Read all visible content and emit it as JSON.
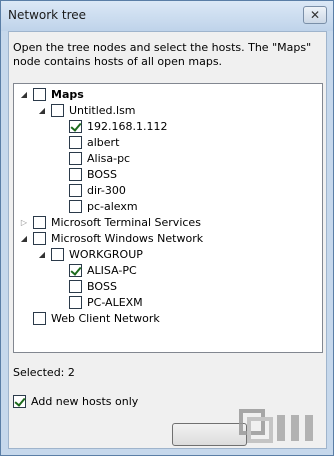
{
  "window": {
    "title": "Network tree",
    "close_glyph": "✕"
  },
  "description": "Open the tree nodes and select the hosts. The \"Maps\" node contains hosts of all open maps.",
  "tree": {
    "nodes": [
      {
        "label": "Maps",
        "checked": false,
        "expander": "expanded",
        "bold": true
      },
      {
        "label": "Untitled.lsm",
        "checked": false,
        "expander": "expanded"
      },
      {
        "label": "192.168.1.112",
        "checked": true,
        "expander": "none"
      },
      {
        "label": "albert",
        "checked": false,
        "expander": "none"
      },
      {
        "label": "Alisa-pc",
        "checked": false,
        "expander": "none"
      },
      {
        "label": "BOSS",
        "checked": false,
        "expander": "none"
      },
      {
        "label": "dir-300",
        "checked": false,
        "expander": "none"
      },
      {
        "label": "pc-alexm",
        "checked": false,
        "expander": "none"
      },
      {
        "label": "Microsoft Terminal Services",
        "checked": false,
        "expander": "collapsed"
      },
      {
        "label": "Microsoft Windows Network",
        "checked": false,
        "expander": "expanded"
      },
      {
        "label": "WORKGROUP",
        "checked": false,
        "expander": "expanded"
      },
      {
        "label": "ALISA-PC",
        "checked": true,
        "expander": "none"
      },
      {
        "label": "BOSS",
        "checked": false,
        "expander": "none"
      },
      {
        "label": "PC-ALEXM",
        "checked": false,
        "expander": "none"
      },
      {
        "label": "Web Client Network",
        "checked": false,
        "expander": "none"
      }
    ]
  },
  "status": "Selected: 2",
  "add_new_hosts": {
    "label": "Add new hosts only",
    "checked": true
  },
  "ok_button": {
    "label": ""
  },
  "colors": {
    "accent": "#1c6a1c",
    "title_bar": "#c6d8ec"
  },
  "icons": {
    "expanded": "triangle-down-icon",
    "collapsed": "triangle-right-icon",
    "close": "close-icon"
  }
}
